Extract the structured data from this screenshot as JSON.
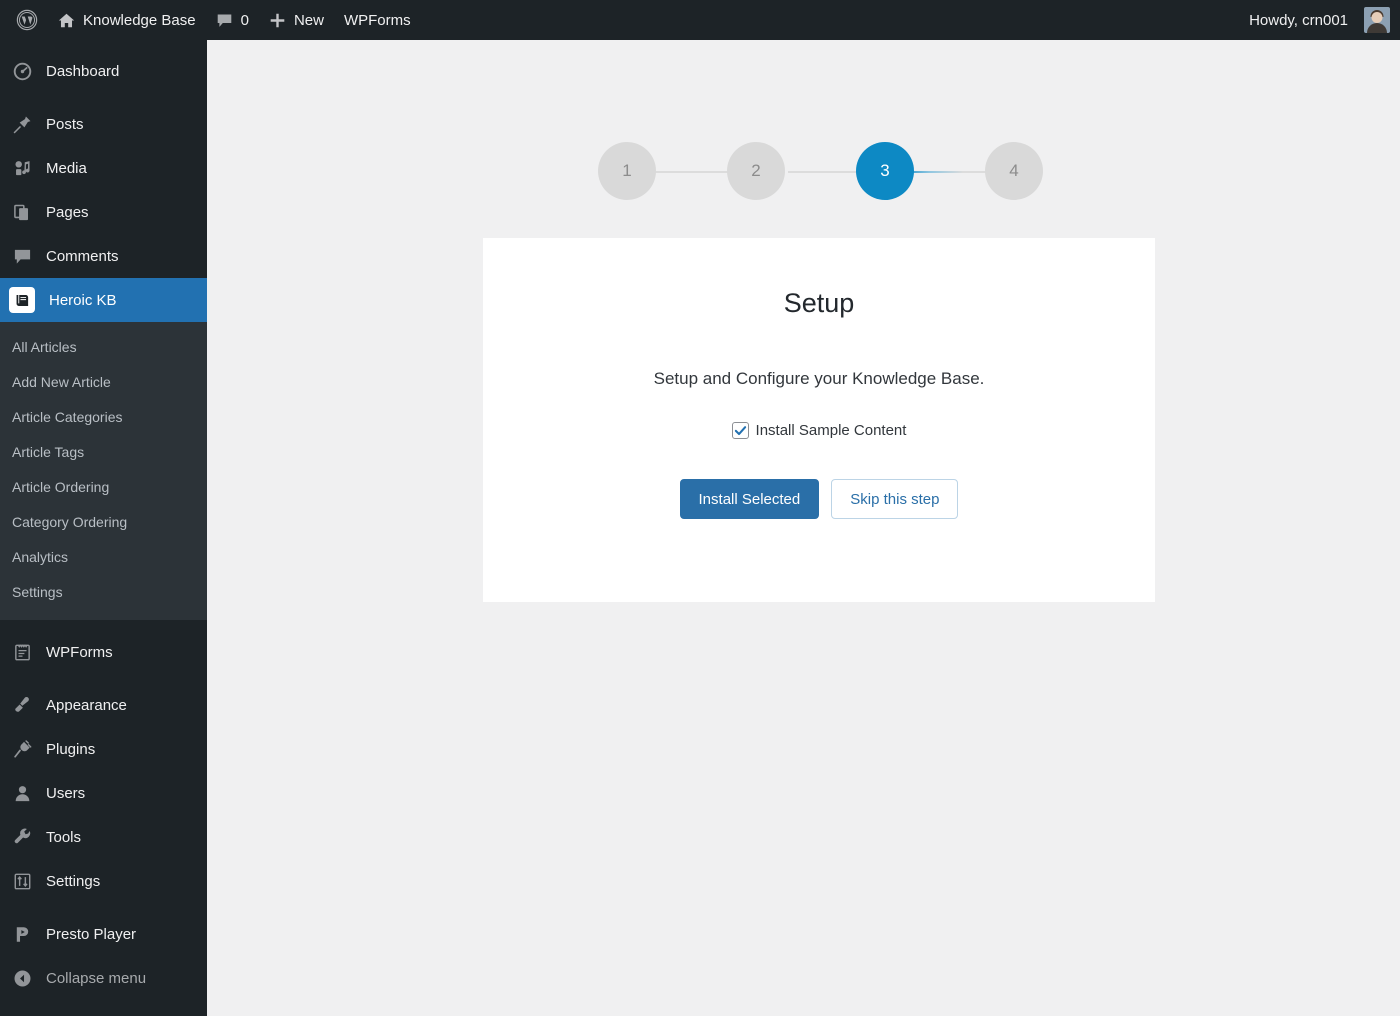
{
  "adminbar": {
    "wp_logo_icon": "wordpress-logo-icon",
    "site_icon": "home-icon",
    "site_name": "Knowledge Base",
    "comments_icon": "comment-bubble-icon",
    "comments_count": "0",
    "new_icon": "plus-icon",
    "new_label": "New",
    "wpforms_label": "WPForms",
    "howdy": "Howdy, crn001",
    "avatar_name": "user-avatar"
  },
  "sidebar": {
    "items": [
      {
        "label": "Dashboard",
        "icon": "dashboard-icon"
      },
      {
        "label": "Posts",
        "icon": "pin-icon"
      },
      {
        "label": "Media",
        "icon": "media-icon"
      },
      {
        "label": "Pages",
        "icon": "pages-icon"
      },
      {
        "label": "Comments",
        "icon": "comment-bubble-icon"
      },
      {
        "label": "Heroic KB",
        "icon": "book-icon",
        "active": true
      },
      {
        "label": "WPForms",
        "icon": "form-icon"
      },
      {
        "label": "Appearance",
        "icon": "paintbrush-icon"
      },
      {
        "label": "Plugins",
        "icon": "plug-icon"
      },
      {
        "label": "Users",
        "icon": "user-icon"
      },
      {
        "label": "Tools",
        "icon": "wrench-icon"
      },
      {
        "label": "Settings",
        "icon": "sliders-icon"
      },
      {
        "label": "Presto Player",
        "icon": "presto-player-icon"
      }
    ],
    "submenu": [
      "All Articles",
      "Add New Article",
      "Article Categories",
      "Article Tags",
      "Article Ordering",
      "Category Ordering",
      "Analytics",
      "Settings"
    ],
    "collapse": {
      "label": "Collapse menu",
      "icon": "collapse-arrow-icon"
    }
  },
  "wizard": {
    "steps": [
      {
        "number": "1",
        "active": false
      },
      {
        "number": "2",
        "active": false
      },
      {
        "number": "3",
        "active": true
      },
      {
        "number": "4",
        "active": false
      }
    ],
    "current_step": "3",
    "total_steps": "4"
  },
  "card": {
    "title": "Setup",
    "description": "Setup and Configure your Knowledge Base.",
    "checkbox": {
      "label": "Install Sample Content",
      "checked": true,
      "icon": "checkmark-icon"
    },
    "primary_button": "Install Selected",
    "secondary_button": "Skip this step"
  },
  "colors": {
    "admin_dark": "#1d2327",
    "submenu_dark": "#2c3338",
    "menu_active_blue": "#2271b1",
    "step_active_blue": "#0d89c4",
    "step_inactive_gray": "#d9d9d9",
    "button_blue": "#2a6fa8",
    "content_bg": "#f0f0f1",
    "card_bg": "#ffffff"
  }
}
